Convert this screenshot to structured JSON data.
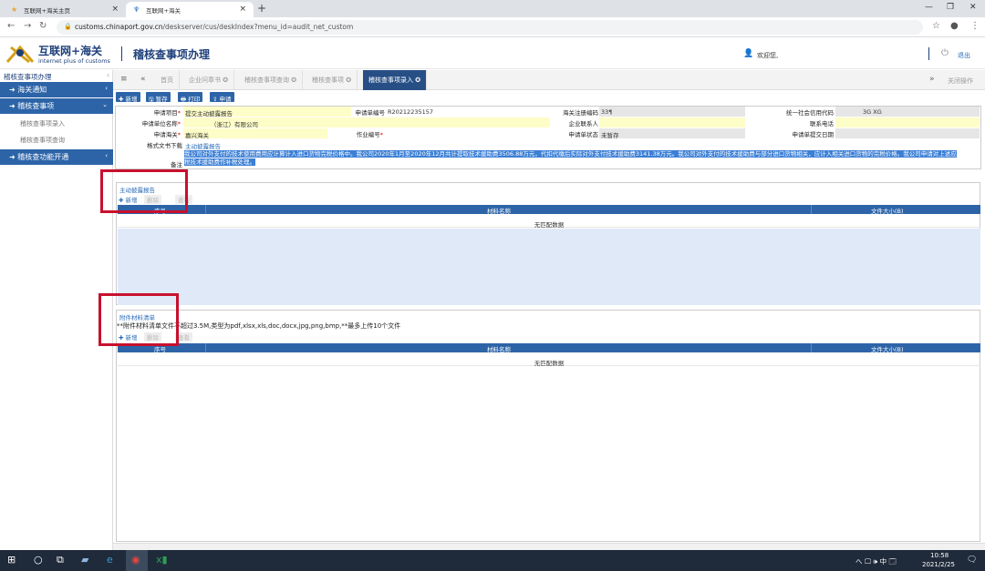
{
  "browser": {
    "tabs": [
      {
        "title": "互联网+海关主页",
        "icon": "star-icon"
      },
      {
        "title": "互联网+海关",
        "icon": "leaf-icon"
      }
    ],
    "url_host": "customs.chinaport.gov.cn",
    "url_path": "/deskserver/cus/deskIndex?menu_id=audit_net_custom"
  },
  "header": {
    "logo_cn": "互联网+海关",
    "logo_en": "internet plus of customs",
    "title": "稽核查事项办理",
    "welcome": "欢迎您,",
    "logout": "退出"
  },
  "sidebar": {
    "title": "稽核查事项办理",
    "menus": [
      {
        "label": "海关通知"
      },
      {
        "label": "稽核查事项"
      },
      {
        "label": "稽核查功能开通"
      }
    ],
    "sub_items": [
      {
        "label": "稽核查事项录入"
      },
      {
        "label": "稽核查事项查询"
      }
    ]
  },
  "page_tabs": {
    "items": [
      {
        "label": "首页"
      },
      {
        "label": "企业问章书 ✪"
      },
      {
        "label": "稽核查事项查询 ✪"
      },
      {
        "label": "稽核查事项 ✪"
      },
      {
        "label": "稽核查事项录入 ✪"
      }
    ],
    "close_ops": "关闭操作"
  },
  "toolbar": {
    "new": "✚ 新增",
    "save": "🖫 暂存",
    "print": "🖶 打印",
    "declare": "⇪ 申请"
  },
  "form": {
    "labels": {
      "apply_item": "申请项目",
      "apply_no": "申请单编号",
      "reg_code": "海关注册编码",
      "credit_code": "统一社会信用代码",
      "apply_unit": "申请单位名称",
      "legal_rep": "企业联系人",
      "phone": "联系电话",
      "customs": "申请海关",
      "work_no": "作业编号",
      "status": "申请单状态",
      "submit_date": "申请单提交日期",
      "template": "格式文书下载",
      "remark": "备注"
    },
    "values": {
      "apply_item": "提交主动披露报告",
      "apply_no": "R20212235157",
      "reg_code": "33¶",
      "credit_code": "3G XG",
      "apply_unit": "（浙江）有限公司",
      "customs": "嘉兴海关",
      "status": "未暂存",
      "template": "主动披露报告",
      "remark": "我公司对外支付的技术使用费用应计算计入进口货物完税价格中。我公司2020年1月至2020年12月共计提取技术援助费3506.88万元，代扣代缴后实际对外支付技术援助费3141.38万元。我公司对外支付的技术援助费与部分进口货物相关，应计入相关进口货物的完税价格。我公司申请对上述应税技术援助费作补税处理。"
    }
  },
  "panel1": {
    "title": "主动披露报告",
    "add": "✚ 新增",
    "delete": "删除",
    "view": "查看",
    "headers": [
      "序号",
      "材料名称",
      "文件大小(B)"
    ],
    "empty": "无匹配数据"
  },
  "panel2": {
    "title": "附件材料清单",
    "note": "**附件材料清单文件不超过3.5M,类型为pdf,xlsx,xls,doc,docx,jpg,png,bmp,**最多上传10个文件",
    "add": "✚ 新增",
    "delete": "删除",
    "view": "查看",
    "headers": [
      "序号",
      "材料名称",
      "文件大小(B)"
    ],
    "empty": "无匹配数据"
  },
  "taskbar": {
    "tray": "へ 🖵 🕪 中 🗔",
    "time": "10:58",
    "date": "2021/2/25"
  },
  "colors": {
    "accent": "#2d64a8",
    "header_text": "#1d3f7a",
    "highlight_box": "#c8102e",
    "field_yellow": "#fdfdc8"
  }
}
